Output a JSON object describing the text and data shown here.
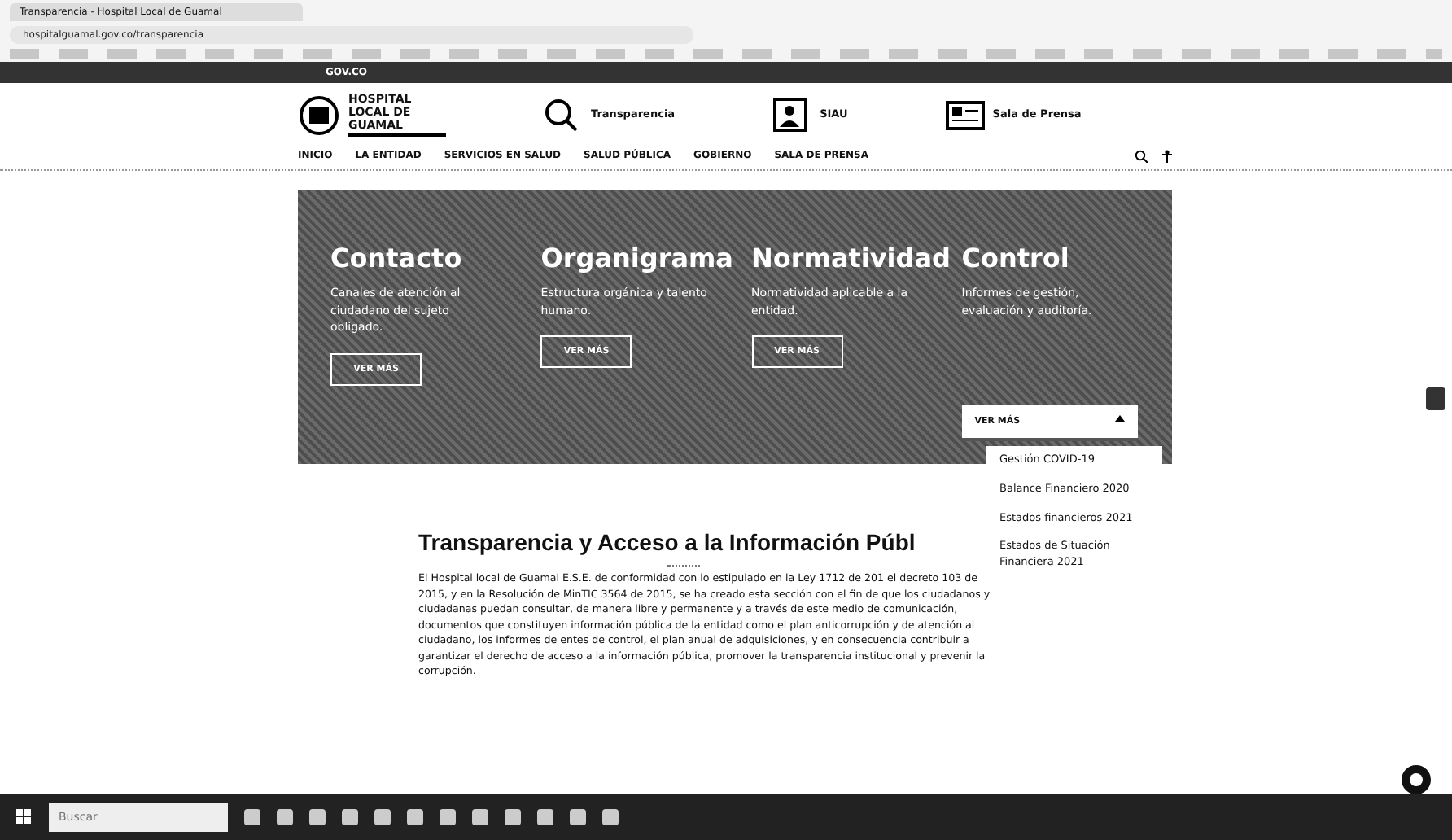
{
  "browser": {
    "tab_title": "Transparencia - Hospital Local de Guamal",
    "address": "hospitalguamal.gov.co/transparencia"
  },
  "gov_bar": {
    "label": "GOV.CO"
  },
  "header": {
    "logo_text": "HOSPITAL LOCAL DE GUAMAL",
    "links": [
      {
        "title": "Transparencia",
        "kind": "search"
      },
      {
        "title": "SIAU",
        "kind": "people"
      },
      {
        "title": "Sala de Prensa",
        "kind": "news"
      }
    ]
  },
  "nav": {
    "items": [
      "INICIO",
      "LA ENTIDAD",
      "SERVICIOS EN SALUD",
      "SALUD PÚBLICA",
      "GOBIERNO",
      "SALA DE PRENSA"
    ]
  },
  "hero_cards": [
    {
      "title": "Contacto",
      "text": "Canales de atención al ciudadano del sujeto obligado.",
      "button": "VER MÁS",
      "expanded": false
    },
    {
      "title": "Organigrama",
      "text": "Estructura orgánica y talento humano.",
      "button": "VER MÁS",
      "expanded": false
    },
    {
      "title": "Normatividad",
      "text": "Normatividad aplicable a la entidad.",
      "button": "VER MÁS",
      "expanded": false
    },
    {
      "title": "Control",
      "text": "Informes de gestión, evaluación y auditoría.",
      "button": "VER MÁS",
      "expanded": true
    }
  ],
  "dropdown": {
    "items": [
      "Gestión COVID-19",
      "Balance Financiero 2020",
      "Estados financieros 2021",
      "Estados de Situación Financiera 2021"
    ]
  },
  "section": {
    "title": "Transparencia y Acceso a la Información Públ",
    "text": "El Hospital local de Guamal E.S.E. de conformidad con lo estipulado en la Ley 1712 de 201 el decreto 103 de 2015, y en la Resolución de MinTIC 3564 de 2015, se ha creado esta sección con el fin de que los ciudadanos y ciudadanas puedan consultar, de manera libre y permanente y a través de este medio de comunicación, documentos que constituyen información pública de la entidad como el plan anticorrupción y de atención al ciudadano, los informes de entes de control, el plan anual de adquisiciones, y en consecuencia contribuir a garantizar el derecho de acceso a la información pública, promover la transparencia institucional y prevenir la corrupción."
  },
  "taskbar": {
    "search_placeholder": "Buscar"
  }
}
